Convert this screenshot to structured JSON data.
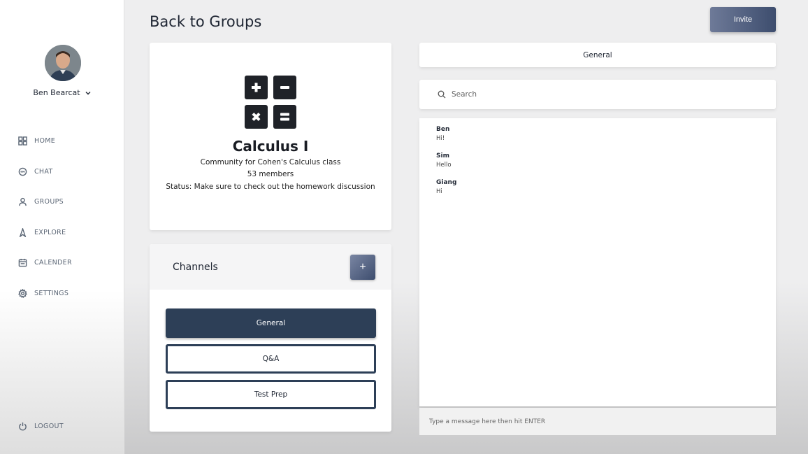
{
  "user": {
    "name": "Ben Bearcat"
  },
  "nav": [
    {
      "label": "HOME",
      "icon": "grid-icon"
    },
    {
      "label": "CHAT",
      "icon": "chat-bubble-icon"
    },
    {
      "label": "GROUPS",
      "icon": "person-icon"
    },
    {
      "label": "EXPLORE",
      "icon": "compass-needle-icon"
    },
    {
      "label": "CALENDER",
      "icon": "calendar-icon"
    },
    {
      "label": "SETTINGS",
      "icon": "gear-icon"
    }
  ],
  "logout_label": "LOGOUT",
  "header": {
    "back_label": "Back to Groups",
    "invite_label": "Invite"
  },
  "group": {
    "name": "Calculus I",
    "description": "Community for Cohen's Calculus class",
    "members": "53 members",
    "status": "Status: Make sure to check out the homework discussion"
  },
  "channels": {
    "title": "Channels",
    "add_label": "+",
    "items": [
      {
        "label": "General",
        "active": true
      },
      {
        "label": "Q&A",
        "active": false
      },
      {
        "label": "Test Prep",
        "active": false
      }
    ]
  },
  "chat": {
    "channel_name": "General",
    "search_placeholder": "Search",
    "messages": [
      {
        "sender": "Ben",
        "text": "Hi!"
      },
      {
        "sender": "Sim",
        "text": "Hello"
      },
      {
        "sender": "Giang",
        "text": "Hi"
      }
    ],
    "composer_placeholder": "Type a message here then hit ENTER"
  },
  "colors": {
    "primary": "#2d3f57",
    "accent_gradient_start": "#6e7a98",
    "accent_gradient_end": "#3d4d6e"
  }
}
